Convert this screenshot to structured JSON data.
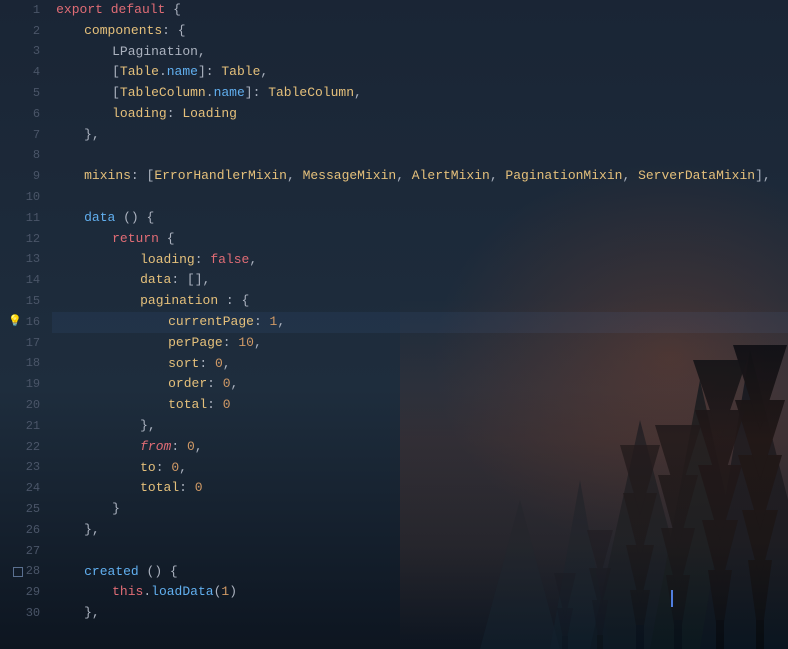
{
  "editor": {
    "background_color": "#1a2535",
    "font_family": "Consolas, Monaco, monospace",
    "font_size": 13,
    "lines": [
      {
        "num": 1,
        "gutter": null,
        "indent": 0,
        "tokens": [
          {
            "t": "kw",
            "v": "export"
          },
          {
            "t": "plain",
            "v": " "
          },
          {
            "t": "kw",
            "v": "default"
          },
          {
            "t": "plain",
            "v": " {"
          }
        ]
      },
      {
        "num": 2,
        "gutter": null,
        "indent": 1,
        "tokens": [
          {
            "t": "prop",
            "v": "components"
          },
          {
            "t": "plain",
            "v": ": {"
          }
        ]
      },
      {
        "num": 3,
        "gutter": null,
        "indent": 2,
        "tokens": [
          {
            "t": "plain",
            "v": "LPagination,"
          }
        ]
      },
      {
        "num": 4,
        "gutter": null,
        "indent": 2,
        "tokens": [
          {
            "t": "plain",
            "v": "["
          },
          {
            "t": "type",
            "v": "Table"
          },
          {
            "t": "plain",
            "v": "."
          },
          {
            "t": "fn",
            "v": "name"
          },
          {
            "t": "plain",
            "v": "]: "
          },
          {
            "t": "type",
            "v": "Table"
          },
          {
            "t": "plain",
            "v": ","
          }
        ]
      },
      {
        "num": 5,
        "gutter": null,
        "indent": 2,
        "tokens": [
          {
            "t": "plain",
            "v": "["
          },
          {
            "t": "type",
            "v": "TableColumn"
          },
          {
            "t": "plain",
            "v": "."
          },
          {
            "t": "fn",
            "v": "name"
          },
          {
            "t": "plain",
            "v": "]: "
          },
          {
            "t": "type",
            "v": "TableColumn"
          },
          {
            "t": "plain",
            "v": ","
          }
        ]
      },
      {
        "num": 6,
        "gutter": null,
        "indent": 2,
        "tokens": [
          {
            "t": "prop",
            "v": "loading"
          },
          {
            "t": "plain",
            "v": ": "
          },
          {
            "t": "type",
            "v": "Loading"
          }
        ]
      },
      {
        "num": 7,
        "gutter": null,
        "indent": 1,
        "tokens": [
          {
            "t": "plain",
            "v": "},"
          }
        ]
      },
      {
        "num": 8,
        "gutter": null,
        "indent": 0,
        "tokens": []
      },
      {
        "num": 9,
        "gutter": null,
        "indent": 1,
        "tokens": [
          {
            "t": "prop",
            "v": "mixins"
          },
          {
            "t": "plain",
            "v": ": ["
          },
          {
            "t": "type",
            "v": "ErrorHandlerMixin"
          },
          {
            "t": "plain",
            "v": ", "
          },
          {
            "t": "type",
            "v": "MessageMixin"
          },
          {
            "t": "plain",
            "v": ", "
          },
          {
            "t": "type",
            "v": "AlertMixin"
          },
          {
            "t": "plain",
            "v": ", "
          },
          {
            "t": "type",
            "v": "PaginationMixin"
          },
          {
            "t": "plain",
            "v": ", "
          },
          {
            "t": "type",
            "v": "ServerDataMixin"
          },
          {
            "t": "plain",
            "v": "],"
          }
        ]
      },
      {
        "num": 10,
        "gutter": null,
        "indent": 0,
        "tokens": []
      },
      {
        "num": 11,
        "gutter": null,
        "indent": 1,
        "tokens": [
          {
            "t": "fn",
            "v": "data"
          },
          {
            "t": "plain",
            "v": " () {"
          }
        ]
      },
      {
        "num": 12,
        "gutter": null,
        "indent": 2,
        "tokens": [
          {
            "t": "kw",
            "v": "return"
          },
          {
            "t": "plain",
            "v": " {"
          }
        ]
      },
      {
        "num": 13,
        "gutter": null,
        "indent": 3,
        "tokens": [
          {
            "t": "prop",
            "v": "loading"
          },
          {
            "t": "plain",
            "v": ": "
          },
          {
            "t": "kw",
            "v": "false"
          },
          {
            "t": "plain",
            "v": ","
          }
        ]
      },
      {
        "num": 14,
        "gutter": null,
        "indent": 3,
        "tokens": [
          {
            "t": "prop",
            "v": "data"
          },
          {
            "t": "plain",
            "v": ": [],"
          }
        ]
      },
      {
        "num": 15,
        "gutter": null,
        "indent": 3,
        "tokens": [
          {
            "t": "prop",
            "v": "pagination"
          },
          {
            "t": "plain",
            "v": " : {"
          }
        ]
      },
      {
        "num": 16,
        "gutter": "lightbulb",
        "indent": 4,
        "tokens": [
          {
            "t": "prop",
            "v": "currentPage"
          },
          {
            "t": "plain",
            "v": ": "
          },
          {
            "t": "num",
            "v": "1"
          },
          {
            "t": "plain",
            "v": ","
          }
        ]
      },
      {
        "num": 17,
        "gutter": null,
        "indent": 4,
        "tokens": [
          {
            "t": "prop",
            "v": "perPage"
          },
          {
            "t": "plain",
            "v": ": "
          },
          {
            "t": "num",
            "v": "10"
          },
          {
            "t": "plain",
            "v": ","
          }
        ]
      },
      {
        "num": 18,
        "gutter": null,
        "indent": 4,
        "tokens": [
          {
            "t": "prop",
            "v": "sort"
          },
          {
            "t": "plain",
            "v": ": "
          },
          {
            "t": "num",
            "v": "0"
          },
          {
            "t": "plain",
            "v": ","
          }
        ]
      },
      {
        "num": 19,
        "gutter": null,
        "indent": 4,
        "tokens": [
          {
            "t": "prop",
            "v": "order"
          },
          {
            "t": "plain",
            "v": ": "
          },
          {
            "t": "num",
            "v": "0"
          },
          {
            "t": "plain",
            "v": ","
          }
        ]
      },
      {
        "num": 20,
        "gutter": null,
        "indent": 4,
        "tokens": [
          {
            "t": "prop",
            "v": "total"
          },
          {
            "t": "plain",
            "v": ": "
          },
          {
            "t": "num",
            "v": "0"
          }
        ]
      },
      {
        "num": 21,
        "gutter": null,
        "indent": 3,
        "tokens": [
          {
            "t": "plain",
            "v": "},"
          }
        ]
      },
      {
        "num": 22,
        "gutter": null,
        "indent": 3,
        "tokens": [
          {
            "t": "kw",
            "v": "from"
          },
          {
            "t": "plain",
            "v": ": "
          },
          {
            "t": "num",
            "v": "0"
          },
          {
            "t": "plain",
            "v": ","
          }
        ]
      },
      {
        "num": 23,
        "gutter": null,
        "indent": 3,
        "tokens": [
          {
            "t": "prop",
            "v": "to"
          },
          {
            "t": "plain",
            "v": ": "
          },
          {
            "t": "num",
            "v": "0"
          },
          {
            "t": "plain",
            "v": ","
          }
        ]
      },
      {
        "num": 24,
        "gutter": null,
        "indent": 3,
        "tokens": [
          {
            "t": "prop",
            "v": "total"
          },
          {
            "t": "plain",
            "v": ": "
          },
          {
            "t": "num",
            "v": "0"
          }
        ]
      },
      {
        "num": 25,
        "gutter": null,
        "indent": 2,
        "tokens": [
          {
            "t": "plain",
            "v": "}"
          }
        ]
      },
      {
        "num": 26,
        "gutter": null,
        "indent": 1,
        "tokens": [
          {
            "t": "plain",
            "v": "},"
          }
        ]
      },
      {
        "num": 27,
        "gutter": null,
        "indent": 0,
        "tokens": []
      },
      {
        "num": 28,
        "gutter": "square",
        "indent": 1,
        "tokens": [
          {
            "t": "fn",
            "v": "created"
          },
          {
            "t": "plain",
            "v": " () {"
          }
        ]
      },
      {
        "num": 29,
        "gutter": null,
        "indent": 2,
        "tokens": [
          {
            "t": "kw",
            "v": "this"
          },
          {
            "t": "plain",
            "v": "."
          },
          {
            "t": "fn",
            "v": "loadData"
          },
          {
            "t": "plain",
            "v": "("
          },
          {
            "t": "num",
            "v": "1"
          },
          {
            "t": "plain",
            "v": ")"
          }
        ]
      },
      {
        "num": 30,
        "gutter": null,
        "indent": 1,
        "tokens": [
          {
            "t": "plain",
            "v": "},"
          }
        ]
      }
    ]
  }
}
